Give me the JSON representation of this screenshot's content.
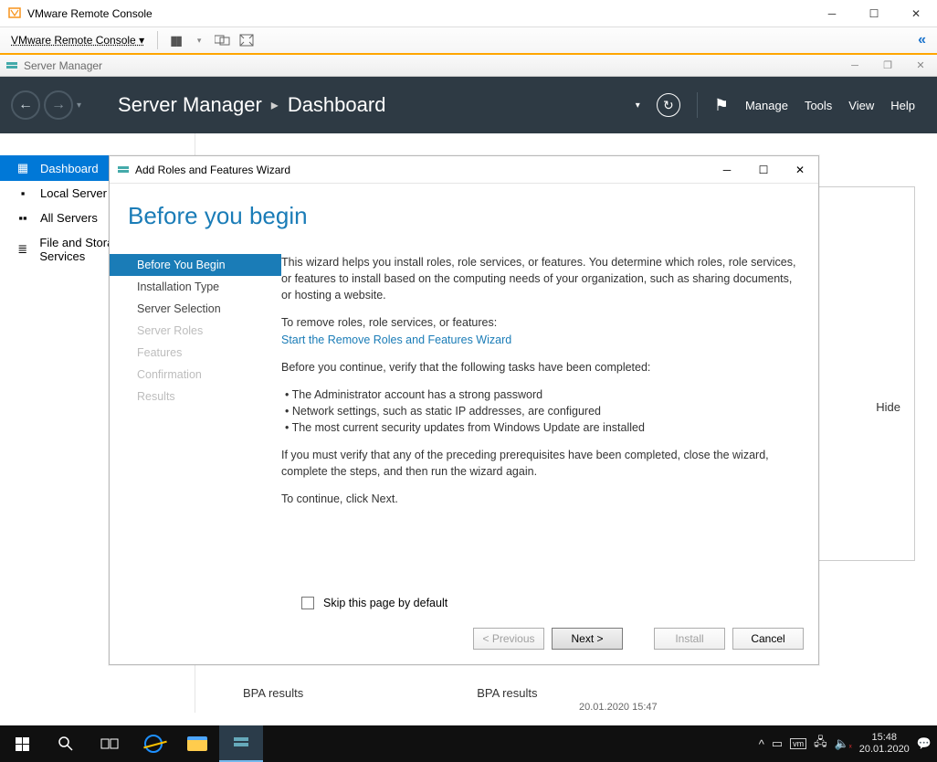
{
  "vmrc": {
    "title": "VMware Remote Console",
    "menu_label": "VMware Remote Console"
  },
  "server_manager": {
    "title": "Server Manager",
    "breadcrumb": {
      "root": "Server Manager",
      "current": "Dashboard"
    },
    "menu": {
      "manage": "Manage",
      "tools": "Tools",
      "view": "View",
      "help": "Help"
    },
    "sidebar": {
      "dashboard": "Dashboard",
      "local_server": "Local Server",
      "all_servers": "All Servers",
      "file_storage": "File and Storage Services"
    },
    "hide": "Hide",
    "bpa_left": "BPA results",
    "bpa_right": "BPA results",
    "bpa_time": "20.01.2020 15:47"
  },
  "wizard": {
    "title": "Add Roles and Features Wizard",
    "heading": "Before you begin",
    "steps": {
      "s1": "Before You Begin",
      "s2": "Installation Type",
      "s3": "Server Selection",
      "s4": "Server Roles",
      "s5": "Features",
      "s6": "Confirmation",
      "s7": "Results"
    },
    "p1": "This wizard helps you install roles, role services, or features. You determine which roles, role services, or features to install based on the computing needs of your organization, such as sharing documents, or hosting a website.",
    "remove_intro": "To remove roles, role services, or features:",
    "remove_link": "Start the Remove Roles and Features Wizard",
    "verify_intro": "Before you continue, verify that the following tasks have been completed:",
    "b1": "The Administrator account has a strong password",
    "b2": "Network settings, such as static IP addresses, are configured",
    "b3": "The most current security updates from Windows Update are installed",
    "closing": "If you must verify that any of the preceding prerequisites have been completed, close the wizard, complete the steps, and then run the wizard again.",
    "continue": "To continue, click Next.",
    "skip": "Skip this page by default",
    "buttons": {
      "prev": "< Previous",
      "next": "Next >",
      "install": "Install",
      "cancel": "Cancel"
    }
  },
  "taskbar": {
    "time": "15:48",
    "date": "20.01.2020"
  }
}
